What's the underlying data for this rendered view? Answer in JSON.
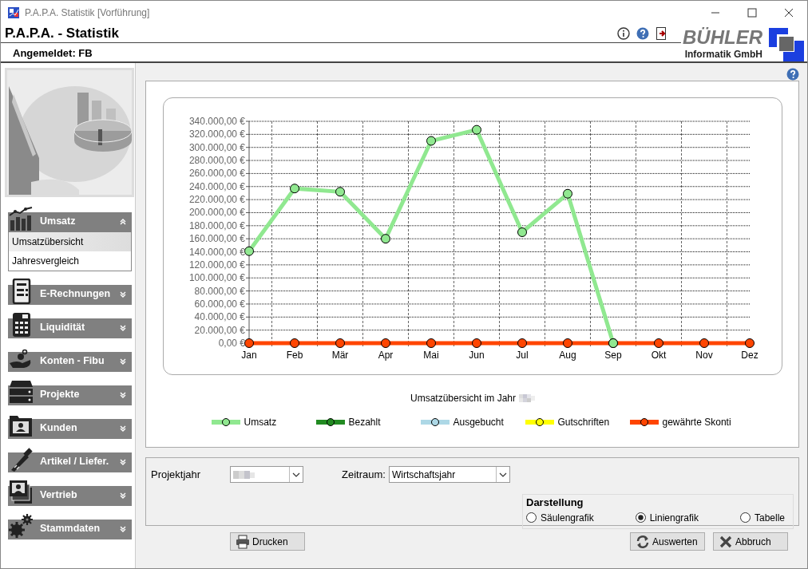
{
  "window": {
    "title": "P.A.P.A. Statistik [Vorführung]"
  },
  "header": {
    "title": "P.A.P.A. - Statistik",
    "user": "Angemeldet: FB",
    "logo_name": "BÜHLER",
    "logo_subtitle": "Informatik GmbH"
  },
  "sidebar": {
    "sections": [
      {
        "label": "Umsatz",
        "expanded": true,
        "items": [
          {
            "label": "Umsatzübersicht",
            "selected": true
          },
          {
            "label": "Jahresvergleich",
            "selected": false
          }
        ]
      },
      {
        "label": "E-Rechnungen",
        "expanded": false
      },
      {
        "label": "Liquidität",
        "expanded": false
      },
      {
        "label": "Konten - Fibu",
        "expanded": false
      },
      {
        "label": "Projekte",
        "expanded": false
      },
      {
        "label": "Kunden",
        "expanded": false
      },
      {
        "label": "Artikel / Liefer.",
        "expanded": false
      },
      {
        "label": "Vertrieb",
        "expanded": false
      },
      {
        "label": "Stammdaten",
        "expanded": false
      }
    ]
  },
  "chart": {
    "caption": "Umsatzübersicht im Jahr",
    "chart_data": {
      "type": "line",
      "categories": [
        "Jan",
        "Feb",
        "Mär",
        "Apr",
        "Mai",
        "Jun",
        "Jul",
        "Aug",
        "Sep",
        "Okt",
        "Nov",
        "Dez"
      ],
      "ylim": [
        0,
        340000
      ],
      "yticks": [
        {
          "value": 0,
          "label": "0,00 €"
        },
        {
          "value": 20000,
          "label": "20.000,00 €"
        },
        {
          "value": 40000,
          "label": "40.000,00 €"
        },
        {
          "value": 60000,
          "label": "60.000,00 €"
        },
        {
          "value": 80000,
          "label": "80.000,00 €"
        },
        {
          "value": 100000,
          "label": "100.000,00 €"
        },
        {
          "value": 120000,
          "label": "120.000,00 €"
        },
        {
          "value": 140000,
          "label": "140.000,00 €"
        },
        {
          "value": 160000,
          "label": "160.000,00 €"
        },
        {
          "value": 180000,
          "label": "180.000,00 €"
        },
        {
          "value": 200000,
          "label": "200.000,00 €"
        },
        {
          "value": 220000,
          "label": "220.000,00 €"
        },
        {
          "value": 240000,
          "label": "240.000,00 €"
        },
        {
          "value": 260000,
          "label": "260.000,00 €"
        },
        {
          "value": 280000,
          "label": "280.000,00 €"
        },
        {
          "value": 300000,
          "label": "300.000,00 €"
        },
        {
          "value": 320000,
          "label": "320.000,00 €"
        },
        {
          "value": 340000,
          "label": "340.000,00 €"
        }
      ],
      "grid": true,
      "series": [
        {
          "name": "Umsatz",
          "color": "#90e890",
          "marker": "circle",
          "values": [
            141000,
            237000,
            232000,
            160000,
            310000,
            327000,
            170000,
            229000,
            0,
            null,
            null,
            null
          ]
        },
        {
          "name": "Bezahlt",
          "color": "#228b22",
          "marker": "circle",
          "values": [
            null,
            null,
            null,
            null,
            null,
            null,
            null,
            null,
            null,
            null,
            null,
            null
          ]
        },
        {
          "name": "Ausgebucht",
          "color": "#add8e6",
          "marker": "circle",
          "values": [
            null,
            null,
            null,
            null,
            null,
            null,
            null,
            null,
            null,
            null,
            null,
            null
          ]
        },
        {
          "name": "Gutschriften",
          "color": "#ffff00",
          "marker": "circle",
          "values": [
            null,
            null,
            null,
            null,
            null,
            null,
            null,
            null,
            null,
            null,
            null,
            null
          ]
        },
        {
          "name": "gewährte Skonti",
          "color": "#ff4500",
          "marker": "circle",
          "values": [
            0,
            0,
            0,
            0,
            0,
            0,
            0,
            0,
            0,
            0,
            0,
            0
          ]
        }
      ]
    }
  },
  "filters": {
    "project_year_label": "Projektjahr",
    "period_label": "Zeitraum:",
    "period_value": "Wirtschaftsjahr",
    "display": {
      "title": "Darstellung",
      "options": [
        {
          "label": "Säulengrafik",
          "selected": false
        },
        {
          "label": "Liniengrafik",
          "selected": true
        },
        {
          "label": "Tabelle",
          "selected": false
        }
      ]
    }
  },
  "buttons": [
    {
      "label": "Drucken",
      "kind": "print"
    },
    {
      "label": "Auswerten",
      "kind": "refresh"
    },
    {
      "label": "Abbruch",
      "kind": "cancel"
    }
  ]
}
